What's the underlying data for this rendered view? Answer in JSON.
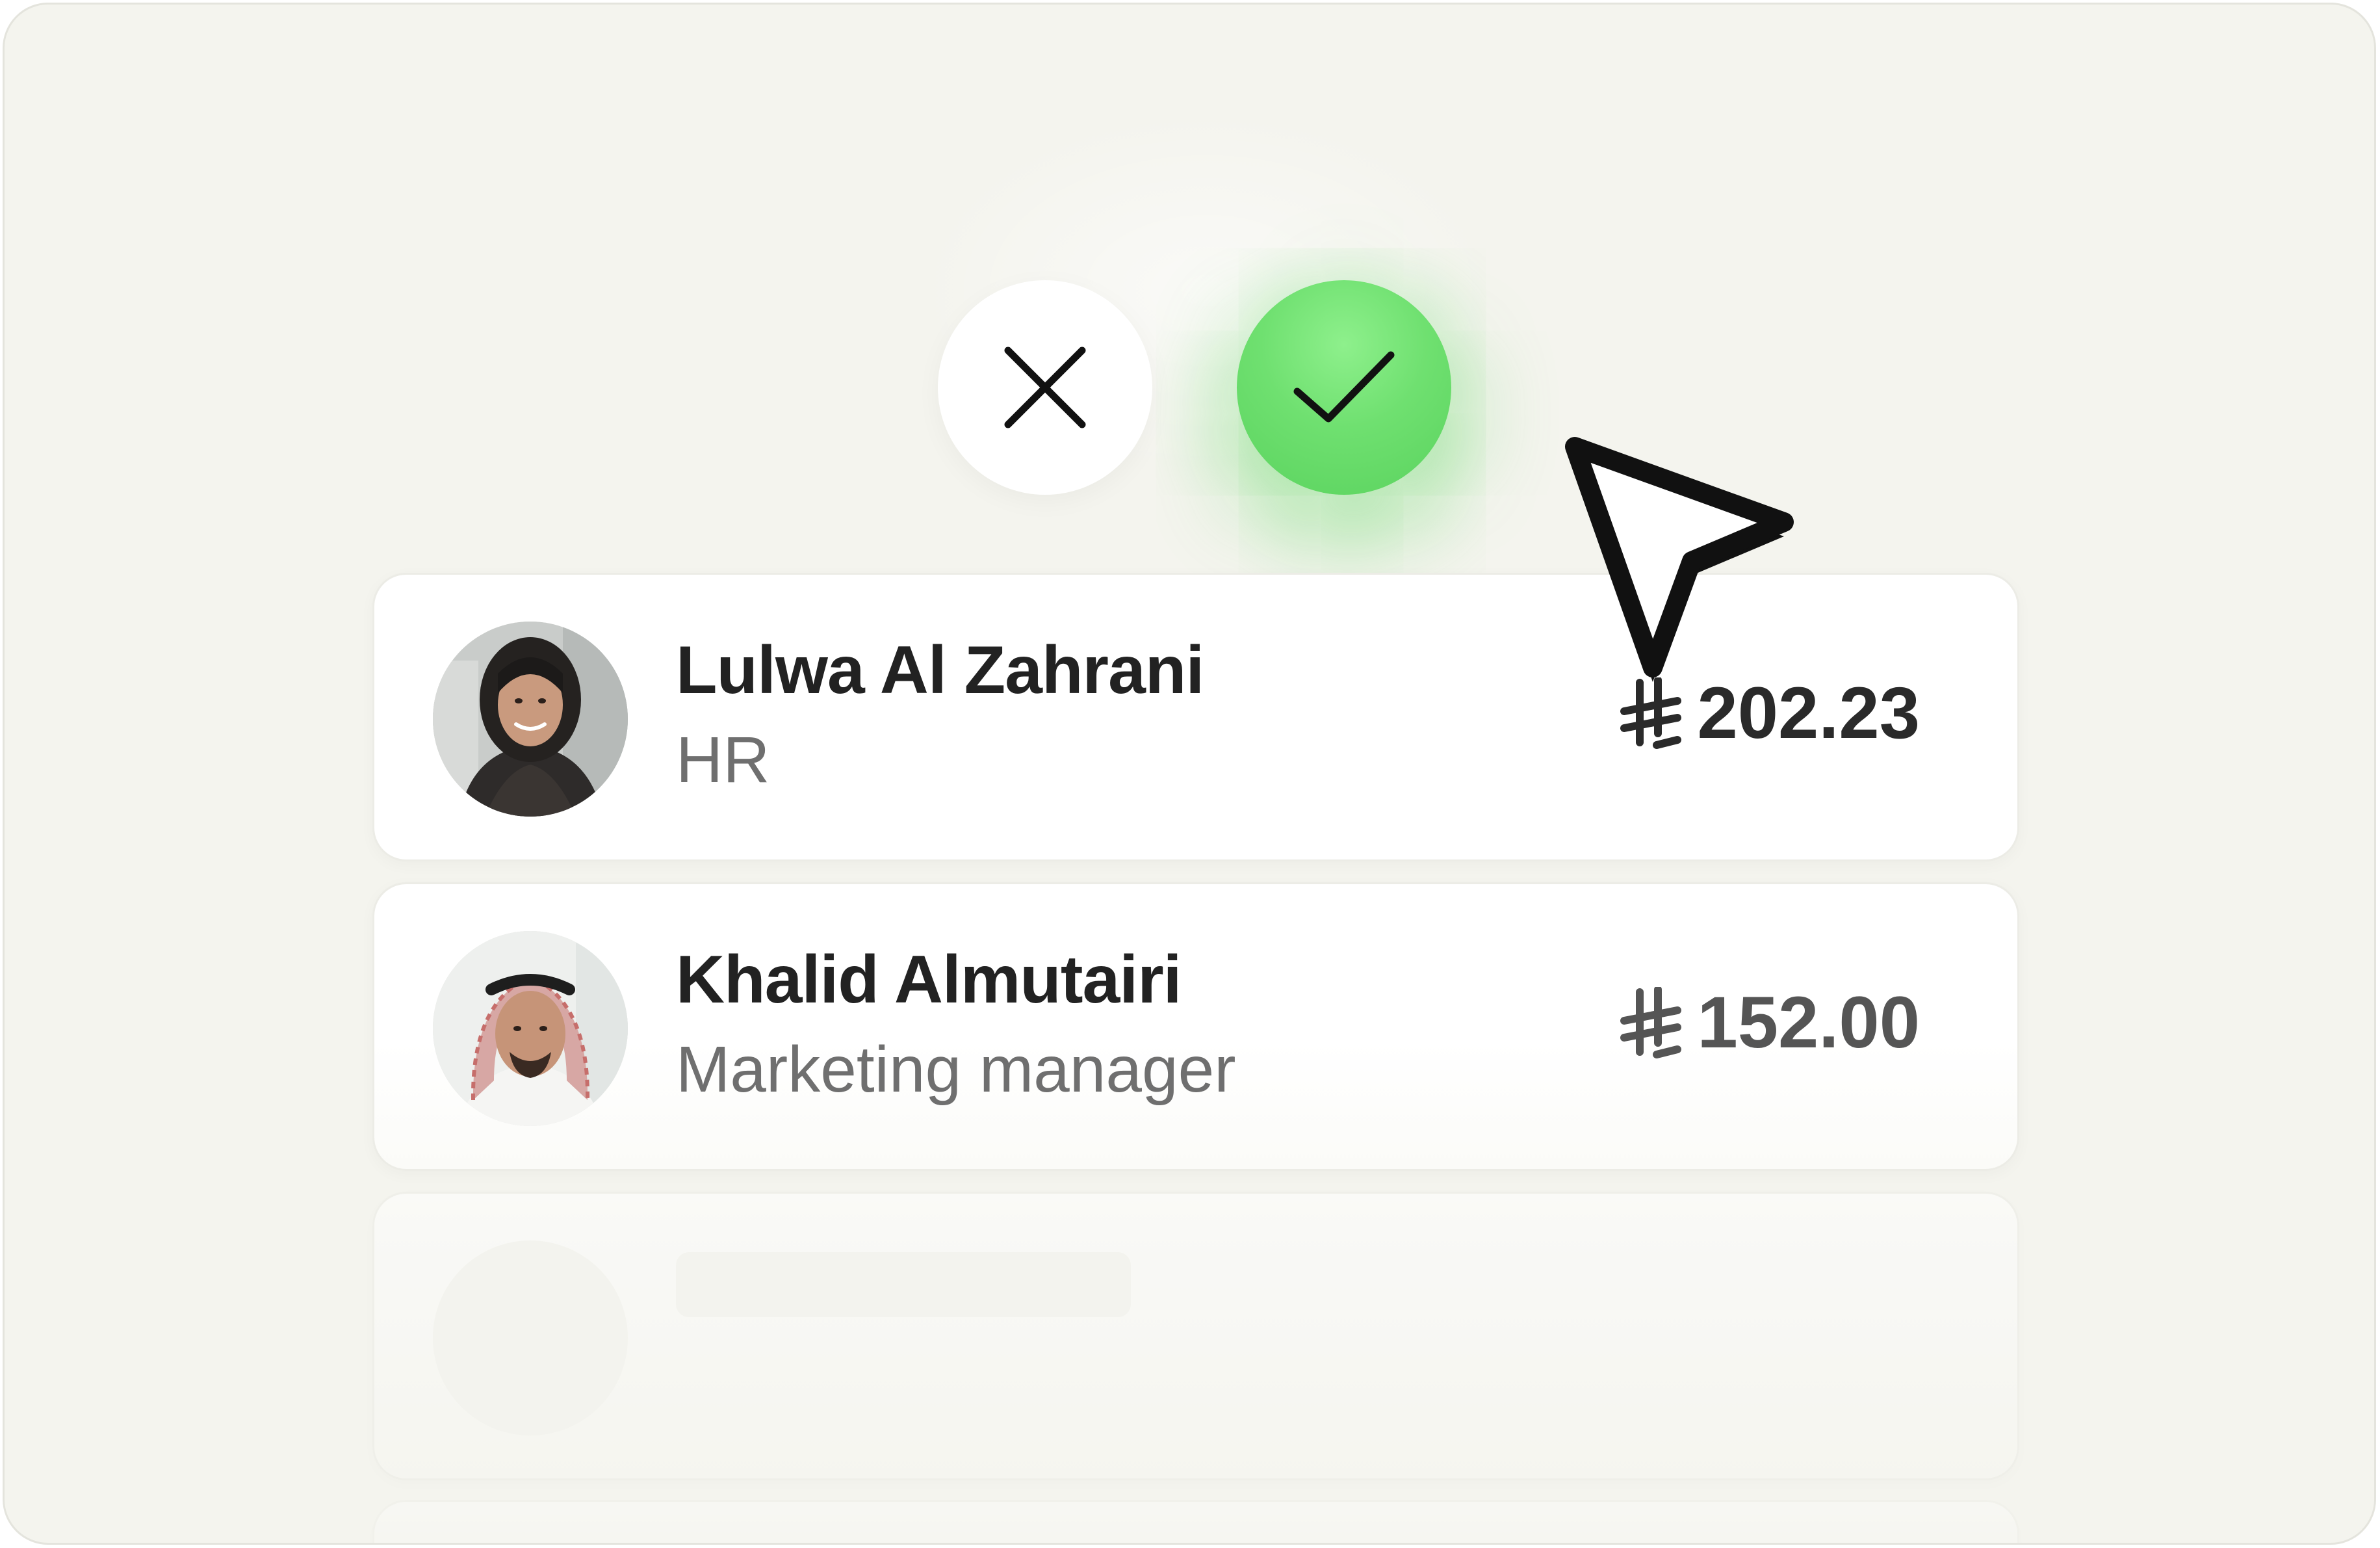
{
  "actions": {
    "reject": {
      "icon": "close-icon"
    },
    "approve": {
      "icon": "check-icon",
      "color": "#62d965"
    }
  },
  "employees": [
    {
      "name": "Lulwa Al Zahrani",
      "role": "HR",
      "amount": "202.23",
      "currency_icon": "saudi-riyal-icon",
      "avatar_icon": "avatar-woman-hijab"
    },
    {
      "name": "Khalid Almutairi",
      "role": "Marketing manager",
      "amount": "152.00",
      "currency_icon": "saudi-riyal-icon",
      "avatar_icon": "avatar-man-shemagh"
    }
  ],
  "cursor": {
    "icon": "pointer-cursor-icon"
  },
  "colors": {
    "background": "#f4f4ee",
    "card": "#ffffff",
    "text": "#222222",
    "muted": "#6f6f6f"
  }
}
